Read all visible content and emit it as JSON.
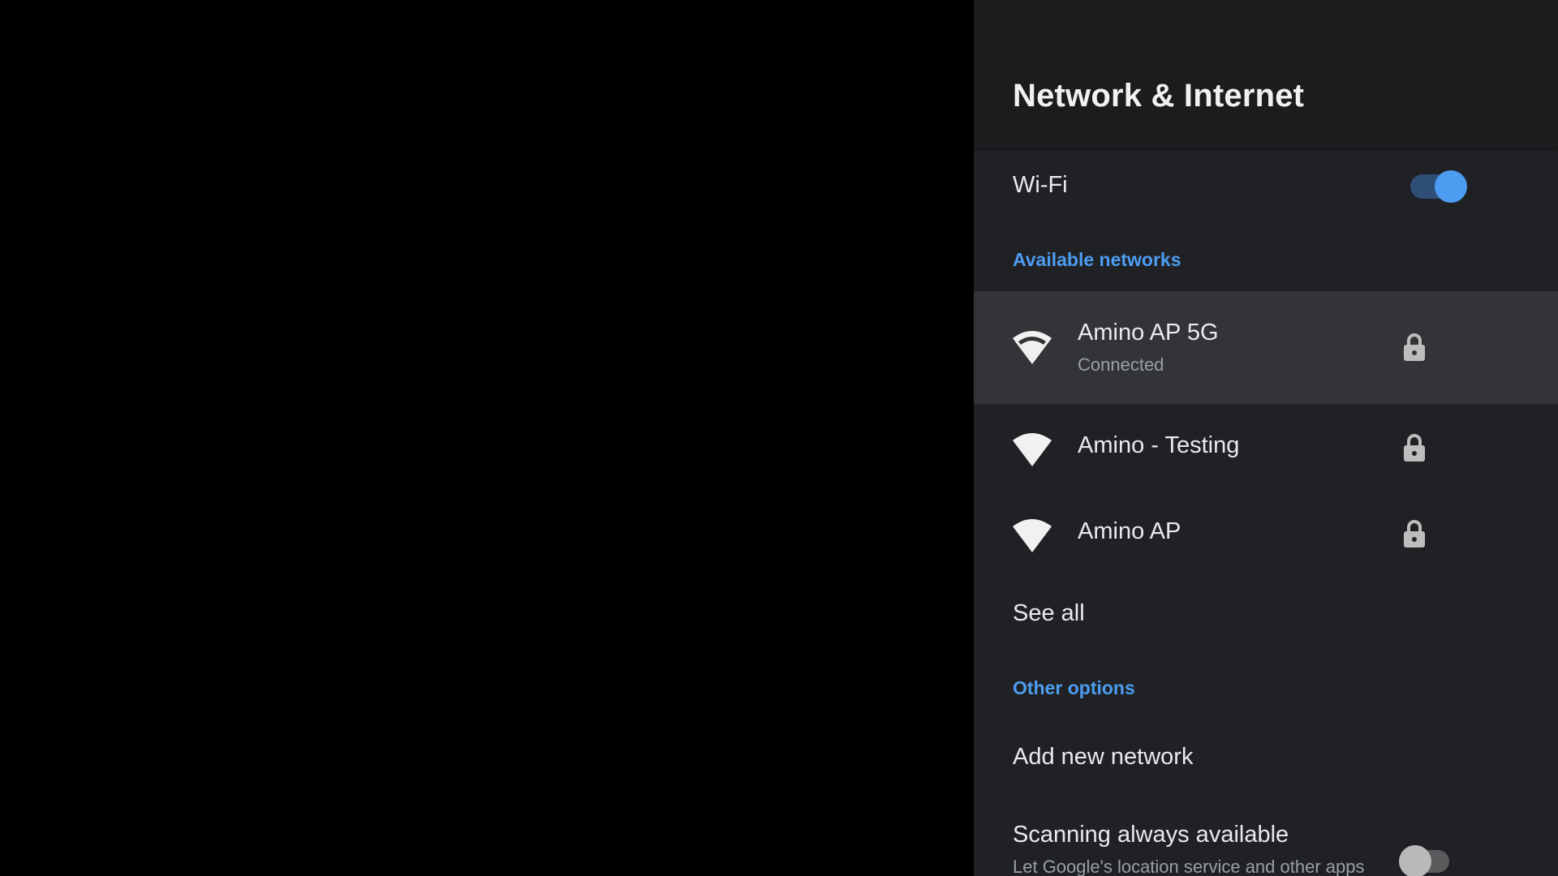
{
  "header": {
    "title": "Network & Internet"
  },
  "wifi": {
    "label": "Wi-Fi",
    "enabled": true
  },
  "sections": {
    "available_networks": "Available networks",
    "other_options": "Other options"
  },
  "networks": [
    {
      "name": "Amino AP 5G",
      "status": "Connected",
      "secured": true,
      "selected": true,
      "icon": "wifi-signal-icon"
    },
    {
      "name": "Amino - Testing",
      "status": "",
      "secured": true,
      "selected": false,
      "icon": "wifi-signal-icon"
    },
    {
      "name": "Amino AP",
      "status": "",
      "secured": true,
      "selected": false,
      "icon": "wifi-signal-icon"
    }
  ],
  "see_all": "See all",
  "add_network": "Add new network",
  "scanning": {
    "label": "Scanning always available",
    "description": "Let Google's location service and other apps",
    "enabled": false
  },
  "colors": {
    "accent": "#4c9df2",
    "panel_bg": "#202124",
    "selected_row_bg": "#333437"
  }
}
